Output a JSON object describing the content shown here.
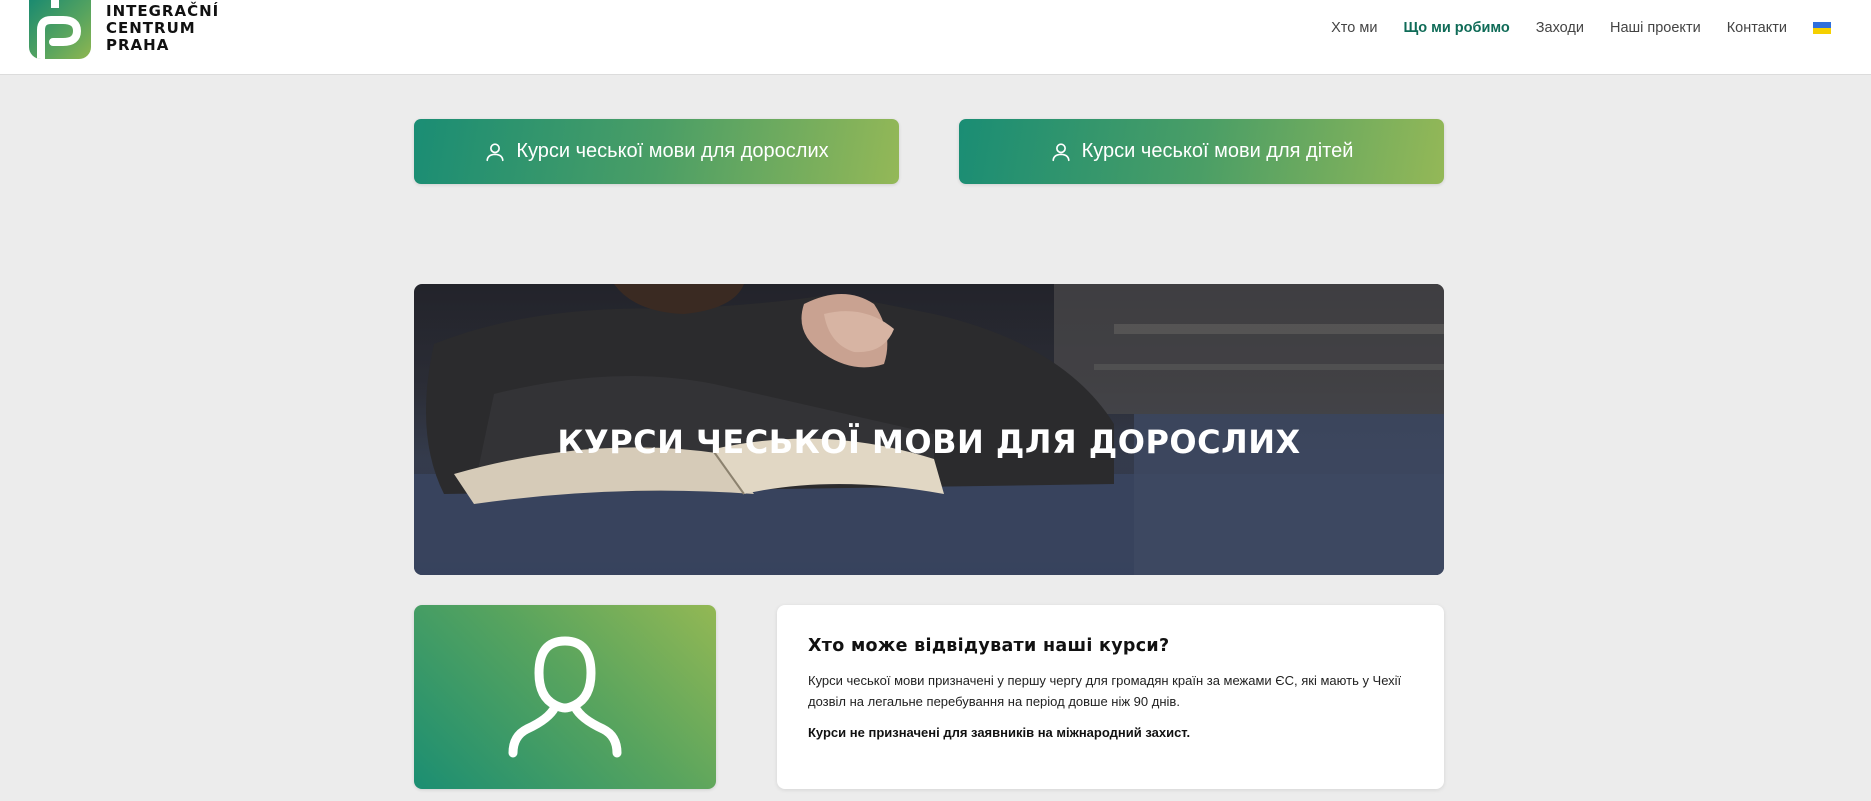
{
  "header": {
    "logo": {
      "line1": "INTEGRAČNÍ",
      "line2": "CENTRUM",
      "line3": "PRAHA"
    },
    "nav": [
      {
        "label": "Хто ми"
      },
      {
        "label": "Що ми робимо",
        "active": true
      },
      {
        "label": "Заходи"
      },
      {
        "label": "Наші проекти"
      },
      {
        "label": "Контакти"
      }
    ],
    "language_icon": "ukraine-flag-icon"
  },
  "course_buttons": [
    {
      "label": "Курси чеської мови для дорослих",
      "icon": "person-icon"
    },
    {
      "label": "Курси чеської мови для дітей",
      "icon": "person-icon"
    }
  ],
  "hero": {
    "title": "КУРСИ ЧЕСЬКОЇ МОВИ ДЛЯ ДОРОСЛИХ"
  },
  "who_card": {
    "icon": "person-icon",
    "title": "Хто може відвідувати наші курси?",
    "text": "Курси чеської мови призначені у першу чергу для громадян країн за межами ЄС, які мають у Чехії дозвіл на легальне перебування на період довше ніж 90 днів.",
    "note": "Курси не призначені для заявників на міжнародний захист."
  },
  "colors": {
    "brand_green": "#1a8d74",
    "brand_lime": "#94b857",
    "active_nav": "#0f6b57",
    "page_bg": "#ececec"
  }
}
